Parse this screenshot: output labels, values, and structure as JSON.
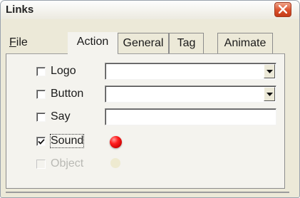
{
  "window": {
    "title": "Links"
  },
  "tabs": [
    {
      "label": "File",
      "mnemonic": "F",
      "rest": "ile"
    },
    {
      "label": "Action"
    },
    {
      "label": "General"
    },
    {
      "label": "Tag"
    },
    {
      "label": "Animate"
    }
  ],
  "options": {
    "logo": {
      "label": "Logo",
      "checked": false,
      "value": ""
    },
    "button": {
      "label": "Button",
      "checked": false,
      "value": ""
    },
    "say": {
      "label": "Say",
      "checked": false,
      "value": ""
    },
    "sound": {
      "label": "Sound",
      "checked": true
    },
    "object": {
      "label": "Object",
      "checked": false,
      "enabled": false
    }
  },
  "colors": {
    "led": "#ff0000",
    "accent_close": "#d9502c"
  }
}
